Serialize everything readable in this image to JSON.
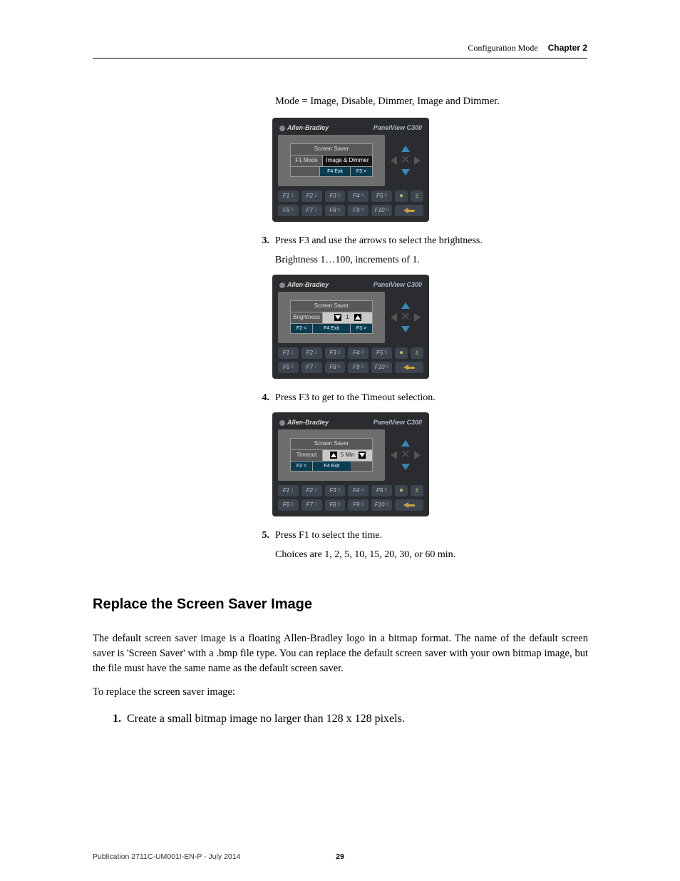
{
  "header": {
    "section": "Configuration Mode",
    "chapter": "Chapter 2"
  },
  "intro_line": "Mode = Image, Disable, Dimmer, Image and Dimmer.",
  "panel_common": {
    "brand": "Allen-Bradley",
    "model": "PanelView C300",
    "fkeys_row1": [
      "F1",
      "F2",
      "F3",
      "F4",
      "F5"
    ],
    "fkeys_row2": [
      "F6",
      "F7",
      "F8",
      "F9",
      "F10"
    ],
    "fkey_subs_row1": [
      "1",
      "2",
      "3",
      "4",
      "5"
    ],
    "fkey_subs_row2": [
      "6",
      "7",
      "8",
      "9",
      "0"
    ]
  },
  "panel1": {
    "screen_title": "Screen Saver",
    "field_label": "F1 Mode",
    "field_value": "Image & Dimmer",
    "btn_left_pad": true,
    "btn_mid": "F4 Exit",
    "btn_right": "F3 >"
  },
  "step3": {
    "num": "3.",
    "text": "Press F3 and use the arrows to select the brightness.",
    "sub": "Brightness 1…100, increments of 1."
  },
  "panel2": {
    "screen_title": "Screen Saver",
    "field_label": "Brightness",
    "field_value": "1",
    "btn_left": "F2 <",
    "btn_mid": "F4 Exit",
    "btn_right": "F3 >"
  },
  "step4": {
    "num": "4.",
    "text": "Press F3 to get to the Timeout selection."
  },
  "panel3": {
    "screen_title": "Screen Saver",
    "field_label": "Timeout",
    "field_value": "5 Min",
    "btn_left": "F2 <",
    "btn_mid": "F4 Exit"
  },
  "step5": {
    "num": "5.",
    "text": "Press F1 to select the time.",
    "sub": "Choices are 1, 2, 5, 10, 15, 20, 30, or 60 min."
  },
  "section_h2": "Replace the Screen Saver Image",
  "body_p1": "The default screen saver image is a floating Allen-Bradley logo in a bitmap format. The name of the default screen saver is 'Screen Saver' with a .bmp file type. You can replace the default screen saver with your own bitmap image, but the file must have the same name as the default screen saver.",
  "body_p2": "To replace the screen saver image:",
  "repl_step1": {
    "num": "1.",
    "text": "Create a small bitmap image no larger than 128 x 128 pixels."
  },
  "footer": {
    "publication": "Publication 2711C-UM001I-EN-P - July 2014",
    "page": "29"
  }
}
